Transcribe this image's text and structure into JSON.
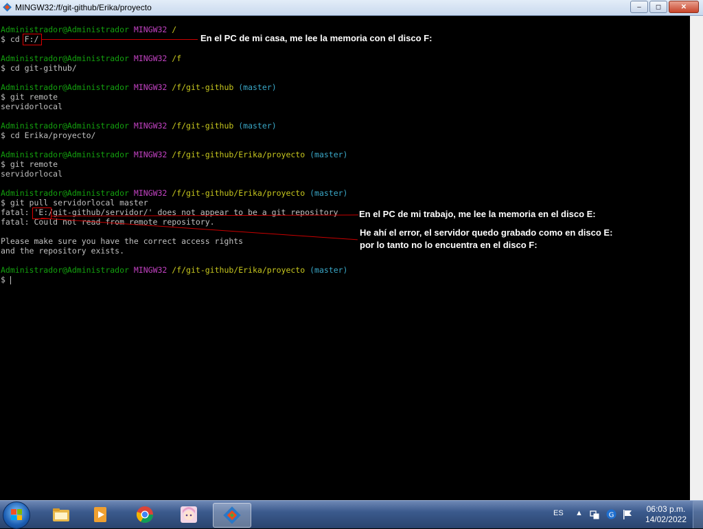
{
  "window": {
    "title": "MINGW32:/f/git-github/Erika/proyecto",
    "minimize_label": "–",
    "maximize_label": "◻",
    "close_label": "✕"
  },
  "prompt": {
    "user_host": "Administrador@Administrador",
    "env": "MINGW32"
  },
  "terminal_lines": [
    {
      "type": "prompt",
      "path": "/",
      "branch": ""
    },
    {
      "type": "command",
      "text": "$ cd F:/"
    },
    {
      "type": "blank"
    },
    {
      "type": "prompt",
      "path": "/f",
      "branch": ""
    },
    {
      "type": "command",
      "text": "$ cd git-github/"
    },
    {
      "type": "blank"
    },
    {
      "type": "prompt",
      "path": "/f/git-github",
      "branch": "(master)"
    },
    {
      "type": "command",
      "text": "$ git remote"
    },
    {
      "type": "output",
      "text": "servidorlocal"
    },
    {
      "type": "blank"
    },
    {
      "type": "prompt",
      "path": "/f/git-github",
      "branch": "(master)"
    },
    {
      "type": "command",
      "text": "$ cd Erika/proyecto/"
    },
    {
      "type": "blank"
    },
    {
      "type": "prompt",
      "path": "/f/git-github/Erika/proyecto",
      "branch": "(master)"
    },
    {
      "type": "command",
      "text": "$ git remote"
    },
    {
      "type": "output",
      "text": "servidorlocal"
    },
    {
      "type": "blank"
    },
    {
      "type": "prompt",
      "path": "/f/git-github/Erika/proyecto",
      "branch": "(master)"
    },
    {
      "type": "command",
      "text": "$ git pull servidorlocal master"
    },
    {
      "type": "output",
      "text": "fatal: 'E:/git-github/servidor/' does not appear to be a git repository"
    },
    {
      "type": "output",
      "text": "fatal: Could not read from remote repository."
    },
    {
      "type": "blank"
    },
    {
      "type": "output",
      "text": "Please make sure you have the correct access rights"
    },
    {
      "type": "output",
      "text": "and the repository exists."
    },
    {
      "type": "blank"
    },
    {
      "type": "prompt",
      "path": "/f/git-github/Erika/proyecto",
      "branch": "(master)"
    },
    {
      "type": "cursor",
      "text": "$ "
    }
  ],
  "annotations": {
    "home_note": "En el PC de mi casa, me lee la memoria con el disco F:",
    "work_note": "En el PC de mi trabajo, me lee la memoria en el disco E:",
    "error_note_1": "He ahí el error, el servidor quedo grabado como en disco E:",
    "error_note_2": "por lo tanto no lo encuentra en el disco F:"
  },
  "taskbar": {
    "language": "ES",
    "time": "06:03 p.m.",
    "date": "14/02/2022",
    "apps": [
      "file-explorer-icon",
      "media-player-icon",
      "chrome-icon",
      "anime-avatar-icon",
      "git-bash-icon"
    ]
  },
  "colors": {
    "prompt_user": "#13a10e",
    "prompt_env": "#c242c2",
    "prompt_path": "#c8c81e",
    "prompt_branch": "#3aa8c8",
    "annotation_line": "#cc0000"
  }
}
